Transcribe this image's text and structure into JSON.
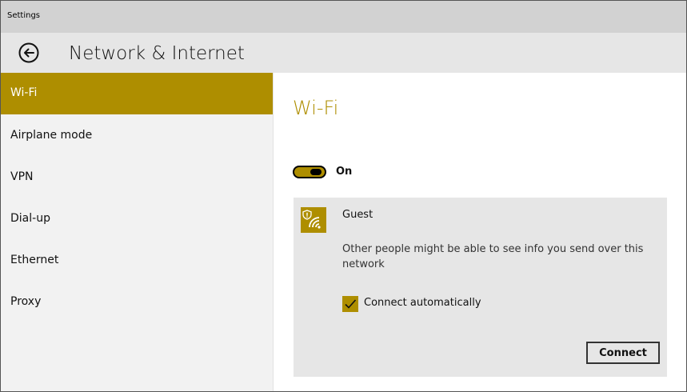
{
  "window": {
    "title": "Settings"
  },
  "header": {
    "back_icon": "back-arrow-icon",
    "title": "Network & Internet"
  },
  "sidebar": {
    "items": [
      {
        "label": "Wi-Fi",
        "active": true
      },
      {
        "label": "Airplane mode",
        "active": false
      },
      {
        "label": "VPN",
        "active": false
      },
      {
        "label": "Dial-up",
        "active": false
      },
      {
        "label": "Ethernet",
        "active": false
      },
      {
        "label": "Proxy",
        "active": false
      }
    ]
  },
  "main": {
    "title": "Wi-Fi",
    "wifi_toggle": {
      "state": "on",
      "label": "On"
    },
    "network": {
      "icon": "wifi-shield-icon",
      "name": "Guest",
      "warning": "Other people might be able to see info you send over this network",
      "connect_automatically": {
        "label": "Connect automatically",
        "checked": true
      },
      "connect_label": "Connect"
    }
  },
  "colors": {
    "accent": "#ae8e00",
    "titlebar": "#d2d2d2",
    "header": "#e6e6e6",
    "sidebar": "#f2f2f2",
    "card": "#e6e6e6"
  }
}
